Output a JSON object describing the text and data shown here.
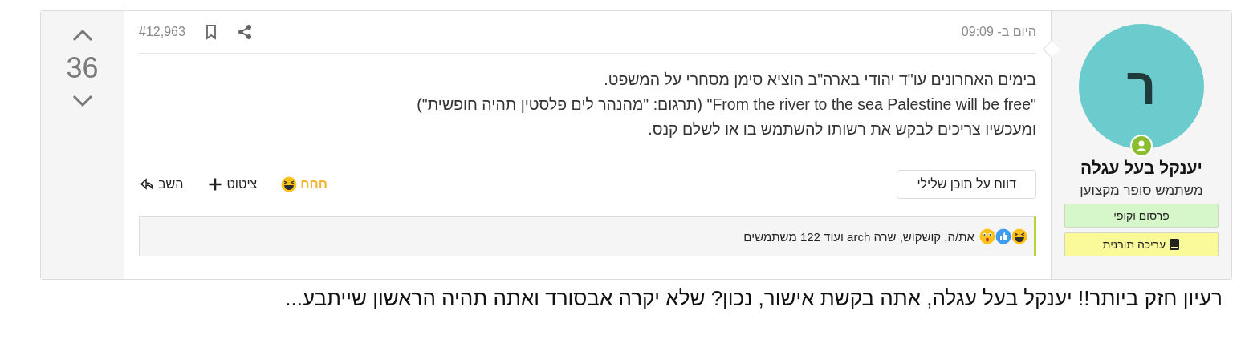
{
  "post": {
    "author": {
      "avatar_letter": "ר",
      "online": true,
      "name": "יענקל בעל עגלה",
      "title": "משתמש סופר מקצוען",
      "badges": [
        {
          "label": "פרסום וקופי",
          "color": "#d6f7c9",
          "kind": "plain"
        },
        {
          "label": "עריכה תורנית",
          "color": "#fbfa9b",
          "kind": "book"
        }
      ]
    },
    "date": "היום ב- 09:09",
    "number": "#12,963",
    "body": [
      "בימים האחרונים עו\"ד יהודי בארה\"ב הוציא סימן מסחרי על המשפט.",
      "\"From the river to the sea Palestine will be free\" (תרגום: \"מהנהר לים פלסטין תהיה חופשית\")",
      "ומעכשיו צריכים לבקש את רשותו להשתמש בו או לשלם קנס."
    ],
    "report_button": "דווח על תוכן שלילי",
    "actions": [
      {
        "kind": "reaction",
        "label": "חחח",
        "reacted": true
      },
      {
        "kind": "quote",
        "label": "ציטוט"
      },
      {
        "kind": "reply",
        "label": "השב"
      }
    ],
    "reactions": {
      "emojis": [
        {
          "kind": "laugh"
        },
        {
          "kind": "like"
        },
        {
          "kind": "wow"
        }
      ],
      "summary": "את/ה, קושקוש, שרה arch ועוד 122 משתמשים"
    },
    "votes": "36"
  },
  "comment": "רעיון חזק ביותר!! יענקל בעל עגלה, אתה בקשת אישור, נכון? שלא יקרה אבסורד ואתה תהיה הראשון שייתבע..."
}
